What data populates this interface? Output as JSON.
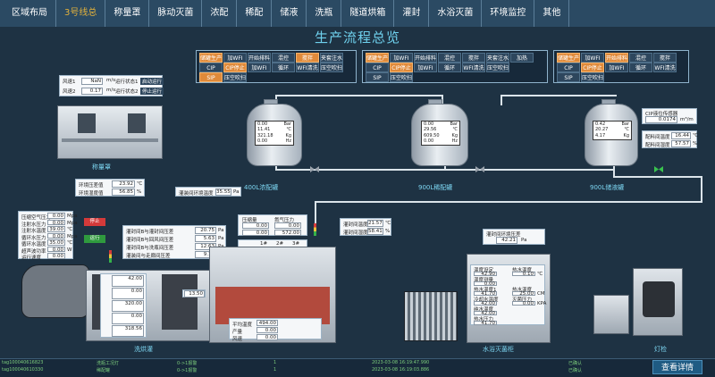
{
  "nav": {
    "tabs": [
      "区域布局",
      "3号线总",
      "称量罩",
      "脉动灭菌",
      "浓配",
      "稀配",
      "储液",
      "洗瓶",
      "隧道烘箱",
      "灌封",
      "水浴灭菌",
      "环境监控",
      "其他"
    ]
  },
  "title": "生产流程总览",
  "proc1": {
    "row1": [
      "储罐生产",
      "加WFI",
      "开始排料",
      "混控",
      "搅拌",
      "夹套注水"
    ],
    "row2": [
      "CIP",
      "CIP停止",
      "加WFI",
      "循环",
      "WFI清洗",
      "压空吹扫"
    ],
    "row3": [
      "SIP",
      "压空吹扫"
    ]
  },
  "proc2": {
    "row1": [
      "储罐生产",
      "加WFI",
      "开始排料",
      "混控",
      "搅拌",
      "夹套注水",
      "加热"
    ],
    "row2": [
      "CIP",
      "CIP停止",
      "加WFI",
      "循环",
      "WFI清洗",
      "压空吹扫"
    ],
    "row3": [
      "SIP",
      "压空吹扫"
    ]
  },
  "proc3": {
    "row1": [
      "储罐生产",
      "加WFI",
      "开始排料",
      "混控",
      "搅拌"
    ],
    "row2": [
      "CIP",
      "CIP停止",
      "加WFI",
      "循环",
      "WFI清洗"
    ],
    "row3": [
      "SIP",
      "压空吹扫"
    ]
  },
  "weigh": {
    "rows": [
      {
        "label": "风速1",
        "value": "NaN",
        "unit": "m/s",
        "status": "运行状态1",
        "btn": "启动运行"
      },
      {
        "label": "风速2",
        "value": "0.17",
        "unit": "m/s",
        "status": "运行状态2",
        "btn": "停止运行"
      }
    ],
    "caption": "称量罩",
    "diff": {
      "l1": "环境压差值",
      "v1": "23.92",
      "u1": "℃",
      "l2": "环境湿度值",
      "v2": "56.85",
      "u2": "%"
    }
  },
  "tank1": {
    "screen": [
      [
        "0.00",
        "Bar"
      ],
      [
        "11.41",
        "℃"
      ],
      [
        "321.18",
        "Kg"
      ],
      [
        "0.00",
        "Hz"
      ]
    ],
    "caption": "400L浓配罐",
    "extra": {
      "label": "灌装间环境温度",
      "value": "35.55",
      "unit": "Pa"
    }
  },
  "tank2": {
    "screen": [
      [
        "0.00",
        "Bar"
      ],
      [
        "29.56",
        "℃"
      ],
      [
        "609.50",
        "Kg"
      ],
      [
        "0.00",
        "Hz"
      ]
    ],
    "caption": "900L稀配罐"
  },
  "tank3": {
    "screen": [
      [
        "0.42",
        "Bar"
      ],
      [
        "20.27",
        "℃"
      ],
      [
        "4.17",
        "Kg"
      ]
    ],
    "caption": "900L储液罐",
    "side": {
      "label": "CIP液位传感器",
      "value": "0.0174",
      "unit": "m³/m"
    },
    "side2": [
      {
        "label": "配料间温度",
        "value": "16.44",
        "unit": "℃"
      },
      {
        "label": "配料间湿度",
        "value": "57.57",
        "unit": "%"
      }
    ]
  },
  "washer": {
    "panel": [
      {
        "l": "压缩空气压力",
        "v": "0.00",
        "u": "Mpa"
      },
      {
        "l": "注射水压力",
        "v": "0.00",
        "u": "Mpa"
      },
      {
        "l": "注射水温度",
        "v": "39.00",
        "u": "℃"
      },
      {
        "l": "循环水压力",
        "v": "0.00",
        "u": "Mpa"
      },
      {
        "l": "循环水温度",
        "v": "35.00",
        "u": "℃"
      },
      {
        "l": "超声波功率",
        "v": "0.00",
        "u": "W"
      },
      {
        "l": "运行速度",
        "v": "0.00",
        "u": ""
      }
    ],
    "stop": "停止",
    "run": "运行",
    "caption": "洗烘灌"
  },
  "tunnel": {
    "panel": [
      {
        "l": "灌封间B与灌封间压差",
        "v": "20.75",
        "u": "Pa"
      },
      {
        "l": "灌封间B与回风间压差",
        "v": "5.63",
        "u": "Pa"
      },
      {
        "l": "灌封间B与洗瓶间压差",
        "v": "12.63",
        "u": "Pa"
      },
      {
        "l": "灌装间与走廊间压差",
        "v": "9.19",
        "u": "Pa"
      }
    ],
    "inner": [
      {
        "l": "",
        "v": "42.00"
      },
      {
        "l": "",
        "v": "0.00"
      },
      {
        "l": "",
        "v": "320.00"
      },
      {
        "l": "",
        "v": "0.00"
      },
      {
        "l": "",
        "v": "318.56"
      }
    ],
    "m1": "13.50",
    "bottom": [
      {
        "l": "平均温度",
        "v": "494.00"
      },
      {
        "l": "产量",
        "v": "0.00"
      },
      {
        "l": "风速",
        "v": "0.00"
      }
    ]
  },
  "filler": {
    "panel": {
      "h1": "压缩量",
      "h2": "氮气压力",
      "r1": [
        "0.00",
        "0.00"
      ],
      "r2": [
        "0.00",
        "572.00"
      ]
    },
    "pos": {
      "h": [
        "1#",
        "2#",
        "3#"
      ],
      "r1": {
        "l": "0.5um",
        "v": [
          "0.00",
          "0.00",
          "0.00"
        ]
      },
      "r2": {
        "l": "5um",
        "v": [
          "0.00",
          "0.00",
          "494.00"
        ]
      }
    },
    "env": [
      {
        "l": "灌封间温度",
        "v": "21.57",
        "u": "℃"
      },
      {
        "l": "灌封间湿度",
        "v": "58.41",
        "u": "%"
      }
    ],
    "m": "0.00"
  },
  "sterilizer": {
    "top": {
      "label": "灌封间环境压差",
      "value": "42.21",
      "unit": "Pa"
    },
    "panel": [
      {
        "l": "温度设定",
        "v": "42.90",
        "l2": "热水温度",
        "v2": "0.10",
        "u2": "℃"
      },
      {
        "l": "温度测量",
        "v": "0.00",
        "l2": "",
        "v2": "",
        "u2": ""
      },
      {
        "l": "热水温度1",
        "v": "41.70",
        "l2": "热水温度",
        "v2": "25.00",
        "u2": "CM"
      },
      {
        "l": "冷却水温度",
        "v": "42.00",
        "l2": "灭菌压力",
        "v2": "0.00",
        "u2": "KPA"
      },
      {
        "l": "纯水温度",
        "v": "42.00",
        "l2": "",
        "v2": "",
        "u2": ""
      },
      {
        "l": "热水压力",
        "v": "41.70",
        "l2": "",
        "v2": "",
        "u2": ""
      }
    ],
    "caption": "水浴灭菌柜"
  },
  "inspect": {
    "caption": "灯检"
  },
  "log": [
    {
      "c1": "tag100040616823",
      "c2": "洗瓶工况灯",
      "c3": "0->1报警",
      "c4": "1",
      "c5": "2023-03-08 16:19:47.990",
      "c6": "已确认"
    },
    {
      "c1": "tag100040610330",
      "c2": "稀配罐",
      "c3": "0->1报警",
      "c4": "1",
      "c5": "2023-03-08 16:19:03.886",
      "c6": "已确认"
    }
  ],
  "detail_button": "查看详情"
}
